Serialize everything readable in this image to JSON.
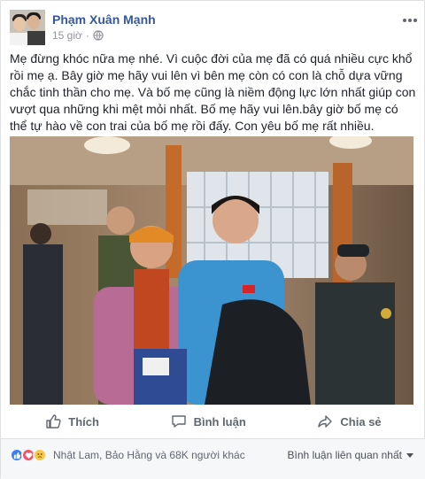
{
  "post": {
    "author": "Phạm Xuân Mạnh",
    "time": "15 giờ",
    "privacy_icon": "globe-icon",
    "more_icon": "more-dots-icon",
    "text": "Mẹ đừng khóc nữa mẹ nhé. Vì cuộc đời của mẹ đã có quá nhiều cực khổ rồi mẹ ạ. Bây giờ mẹ hãy vui lên vì bên mẹ còn có con là chỗ dựa vững chắc tinh thần cho mẹ. Và bố mẹ cũng là niềm động lực lớn nhất giúp con vượt qua những khi mệt mỏi nhất. Bố mẹ hãy vui lên.bây giờ bố mẹ có thể tự hào về con trai của bố mẹ rồi đấy. Con yêu bố mẹ rất nhiều."
  },
  "actions": {
    "like": "Thích",
    "comment": "Bình luận",
    "share": "Chia sẻ"
  },
  "footer": {
    "reactions_text": "Nhật Lam, Bảo Hằng và 68K người khác",
    "sort_label": "Bình luận liên quan nhất"
  },
  "colors": {
    "link": "#365899",
    "like": "#3b7ff3",
    "love": "#f25268",
    "sad": "#f7c844"
  }
}
